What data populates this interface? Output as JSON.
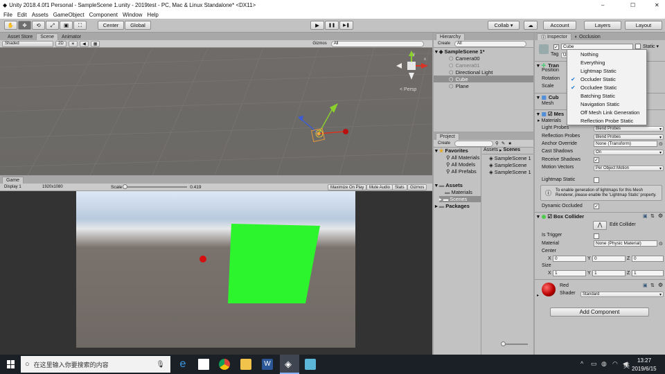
{
  "window": {
    "title": "Unity 2018.4.0f1 Personal - SampleScene 1.unity - 2019test - PC, Mac & Linux Standalone* <DX11>",
    "min": "–",
    "max": "☐",
    "close": "✕"
  },
  "menu": [
    "File",
    "Edit",
    "Assets",
    "GameObject",
    "Component",
    "Window",
    "Help"
  ],
  "toolbar": {
    "tools": [
      "✋",
      "✥",
      "⟲",
      "⤢",
      "▣",
      "⛶"
    ],
    "pivot": "Center",
    "space": "Global",
    "play": "▶",
    "pause": "❚❚",
    "step": "▶❚",
    "collab": "Collab ▾",
    "cloud": "☁",
    "account": "Account",
    "layers": "Layers",
    "layout": "Layout"
  },
  "scene_tabs": {
    "asset_store": "Asset Store",
    "scene": "Scene",
    "animator": "Animator"
  },
  "scene_bar": {
    "shading": "Shaded",
    "mode2d": "2D",
    "gizmos": "Gizmos",
    "search": "All"
  },
  "scene_view": {
    "persp": "< Persp",
    "gizmo_y": "y",
    "gizmo_x": "x"
  },
  "game": {
    "tab": "Game",
    "display": "Display 1",
    "resolution": "1920x1080",
    "scale_label": "Scale",
    "scale_value": "0.419",
    "maximize": "Maximize On Play",
    "mute": "Mute Audio",
    "stats": "Stats",
    "gizmos": "Gizmos"
  },
  "hierarchy": {
    "tab": "Hierarchy",
    "create": "Create",
    "search": "All",
    "scene": "SampleScene 1*",
    "items": [
      "Camera00",
      "Camera01",
      "Directional Light",
      "Cube",
      "Plane"
    ]
  },
  "project": {
    "tab": "Project",
    "create": "Create",
    "favorites": "Favorites",
    "fav_items": [
      "All Materials",
      "All Models",
      "All Prefabs"
    ],
    "assets": "Assets",
    "asset_folders": [
      "Materials",
      "Scenes"
    ],
    "packages": "Packages",
    "breadcrumb": [
      "Assets",
      "Scenes"
    ],
    "files": [
      "SampleScene 1",
      "SampleScene",
      "SampleScene 1"
    ]
  },
  "inspector": {
    "tab": "Inspector",
    "occlusion_tab": "Occlusion",
    "name": "Cube",
    "static": "Static",
    "tag_label": "Tag",
    "tag_value": "Un",
    "transform": {
      "title": "Tran",
      "position": "Position",
      "rotation": "Rotation",
      "scale": "Scale"
    },
    "mesh_filter": {
      "title": "Cub",
      "mesh": "Mesh"
    },
    "mesh_renderer": {
      "title": "Mes",
      "materials": "Materials",
      "light_probes_label": "Light Probes",
      "light_probes": "Blend Probes",
      "reflection_label": "Reflection Probes",
      "reflection": "Blend Probes",
      "anchor_label": "Anchor Override",
      "anchor": "None (Transform)",
      "cast_label": "Cast Shadows",
      "cast": "On",
      "receive_label": "Receive Shadows",
      "motion_label": "Motion Vectors",
      "motion": "Per Object Motion",
      "lightmap_label": "Lightmap Static",
      "info": "To enable generation of lightmaps for this Mesh Renderer, please enable the 'Lightmap Static' property.",
      "occluded_label": "Dynamic Occluded"
    },
    "box_collider": {
      "title": "Box Collider",
      "edit": "Edit Collider",
      "trigger": "Is Trigger",
      "material_label": "Material",
      "material": "None (Physic Material)",
      "center": "Center",
      "size": "Size",
      "cx": "0",
      "cy": "0",
      "cz": "0",
      "sx": "1",
      "sy": "1",
      "sz": "1",
      "x": "X",
      "y": "Y",
      "z": "Z"
    },
    "material": {
      "name": "Red",
      "shader_label": "Shader",
      "shader": "Standard"
    },
    "add_component": "Add Component"
  },
  "static_menu": {
    "items": [
      {
        "label": "Nothing",
        "checked": false
      },
      {
        "label": "Everything",
        "checked": false
      },
      {
        "label": "Lightmap Static",
        "checked": false
      },
      {
        "label": "Occluder Static",
        "checked": true
      },
      {
        "label": "Occludee Static",
        "checked": true
      },
      {
        "label": "Batching Static",
        "checked": false
      },
      {
        "label": "Navigation Static",
        "checked": false
      },
      {
        "label": "Off Mesh Link Generation",
        "checked": false
      },
      {
        "label": "Reflection Probe Static",
        "checked": false
      }
    ]
  },
  "taskbar": {
    "search": "在这里输入你要搜索的内容",
    "time": "13:27",
    "date": "2019/6/15",
    "ime": "英"
  },
  "colors": {
    "cube_green": "#2df52d",
    "sphere_red": "#d41010",
    "selection": "#3d80df"
  }
}
